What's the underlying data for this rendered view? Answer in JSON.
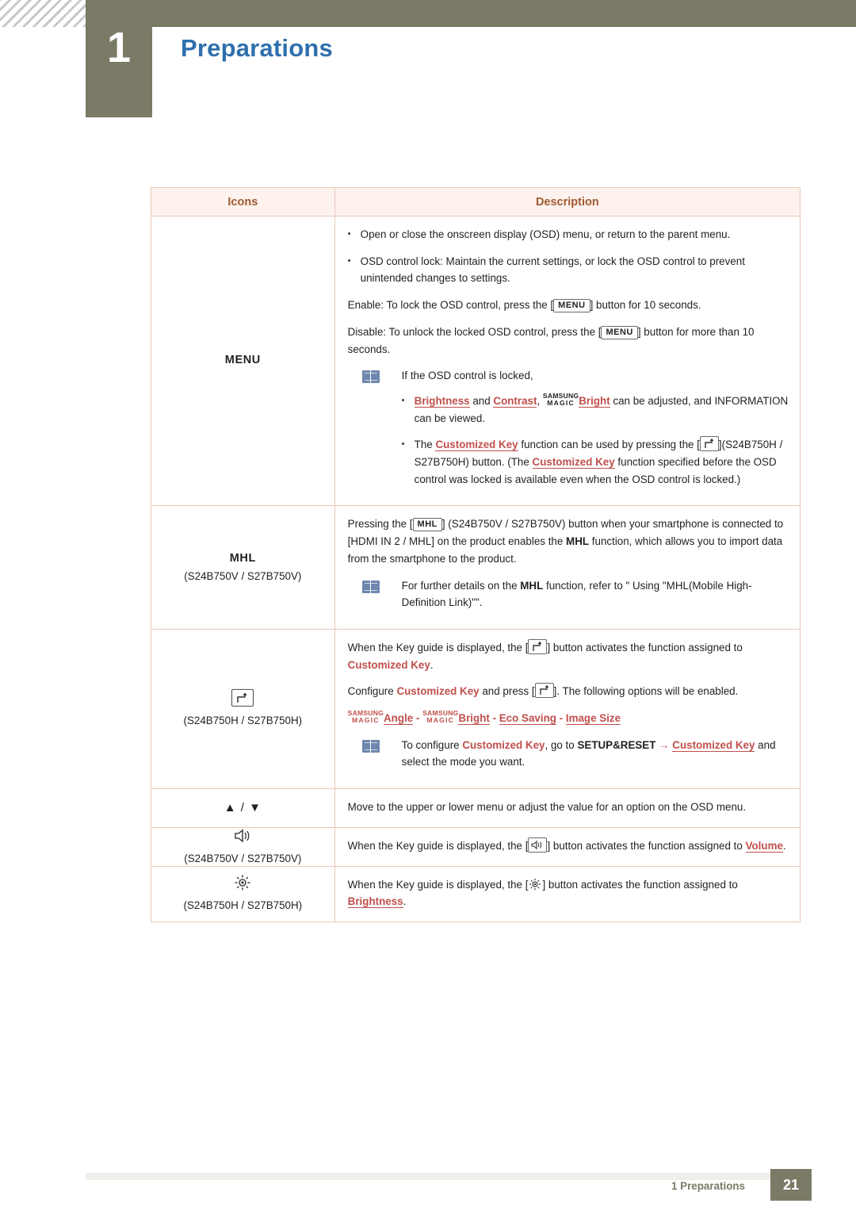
{
  "header": {
    "chapter_number": "1",
    "title": "Preparations"
  },
  "table": {
    "headers": {
      "icons": "Icons",
      "description": "Description"
    },
    "rows": {
      "menu": {
        "icon_label": "MENU",
        "b1": "Open or close the onscreen display (OSD) menu, or return to the parent menu.",
        "b2": "OSD control lock: Maintain the current settings, or lock the OSD control to prevent unintended changes to settings.",
        "enable_pre": "Enable: To lock the OSD control, press the [",
        "enable_key": "MENU",
        "enable_post": "] button for 10 seconds.",
        "disable_pre": "Disable: To unlock the locked OSD control, press the [",
        "disable_key": "MENU",
        "disable_post": "] button for more than 10 seconds.",
        "note_intro": "If the OSD control is locked,",
        "note_b1_a": "Brightness",
        "note_b1_and": " and ",
        "note_b1_b": "Contrast",
        "note_b1_comma": ", ",
        "note_b1_magic_1": "SAMSUNG",
        "note_b1_magic_2": "MAGIC",
        "note_b1_c": "Bright",
        "note_b1_tail": " can be adjusted, and INFORMATION can be viewed.",
        "note_b2_pre": "The ",
        "note_b2_link1": "Customized Key",
        "note_b2_mid": " function can be used by pressing the [",
        "note_b2_mid2": "](S24B750H / S27B750H) button. (The ",
        "note_b2_link2": "Customized Key",
        "note_b2_tail": " function specified before the OSD control was locked is available even when the OSD control is locked.)"
      },
      "mhl": {
        "icon_label": "MHL",
        "icon_sub": "(S24B750V / S27B750V)",
        "p1_pre": "Pressing the [",
        "p1_key": "MHL",
        "p1_mid": "] (S24B750V / S27B750V) button when your smartphone is connected to [HDMI IN 2 / MHL] on the product enables the ",
        "p1_bold": "MHL",
        "p1_tail": " function, which allows you to import data from the smartphone to the product.",
        "note_pre": "For further details on the ",
        "note_bold": "MHL",
        "note_tail": " function, refer to \" Using \"MHL(Mobile High-Definition Link)\"\"."
      },
      "customkey": {
        "icon_sub": "(S24B750H / S27B750H)",
        "p1_pre": "When the Key guide is displayed, the [",
        "p1_post": "] button activates the function assigned to ",
        "p1_link": "Customized Key",
        "p1_end": ".",
        "p2_pre": "Configure ",
        "p2_link": "Customized Key",
        "p2_mid": " and press [",
        "p2_post": "]. The following options will be enabled.",
        "opt_magic1_1": "SAMSUNG",
        "opt_magic1_2": "MAGIC",
        "opt_1": "Angle",
        "sep": " - ",
        "opt_magic2_1": "SAMSUNG",
        "opt_magic2_2": "MAGIC",
        "opt_2": "Bright",
        "opt_3": "Eco Saving",
        "opt_4": "Image Size",
        "note_pre": "To configure ",
        "note_link1": "Customized Key",
        "note_mid": ", go to ",
        "note_bold": "SETUP&RESET",
        "note_arrow": "→",
        "note_link2": "Customized Key",
        "note_tail": " and select the mode you want."
      },
      "updown": {
        "icon_label": "▲ / ▼",
        "p1": "Move to the upper or lower menu or adjust the value for an option on the OSD menu."
      },
      "volume": {
        "icon_sub": "(S24B750V / S27B750V)",
        "p1_pre": "When the Key guide is displayed, the [",
        "p1_post": "] button activates the function assigned to ",
        "p1_link": "Volume",
        "p1_end": "."
      },
      "brightness": {
        "icon_sub": "(S24B750H / S27B750H)",
        "p1_pre": "When the Key guide is displayed, the [",
        "p1_post": "] button activates the function assigned to ",
        "p1_link": "Brightness",
        "p1_end": "."
      }
    }
  },
  "footer": {
    "text": "1 Preparations",
    "page": "21"
  },
  "colors": {
    "chapter_bar": "#7a7a66",
    "title_blue": "#2f6fad",
    "link_red": "#c0504d",
    "table_border": "#e8c9b9",
    "header_fill": "#fdf2ee",
    "header_text": "#a05a30"
  },
  "icons": {
    "custom_key": "custom-key-icon",
    "volume": "volume-icon",
    "brightness": "brightness-icon",
    "note": "note-book-icon"
  }
}
